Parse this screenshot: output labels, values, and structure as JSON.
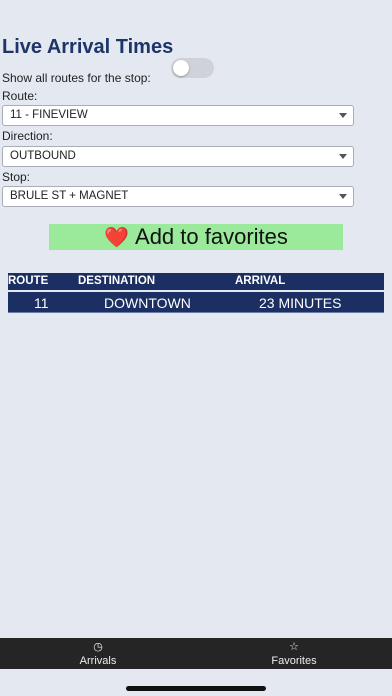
{
  "page": {
    "title": "Live Arrival Times",
    "show_all_label": "Show all routes for the stop:"
  },
  "toggle": {
    "on": false
  },
  "form": {
    "route": {
      "label": "Route:",
      "value": "11 - FINEVIEW"
    },
    "direction": {
      "label": "Direction:",
      "value": "OUTBOUND"
    },
    "stop": {
      "label": "Stop:",
      "value": "BRULE ST + MAGNET"
    }
  },
  "favorites_button": {
    "icon": "heart-icon",
    "glyph": "❤️",
    "label": "Add to favorites"
  },
  "table": {
    "headers": [
      "ROUTE",
      "DESTINATION",
      "ARRIVAL"
    ],
    "rows": [
      {
        "route": "11",
        "destination": "DOWNTOWN",
        "arrival": "23 MINUTES"
      }
    ]
  },
  "tabbar": {
    "items": [
      {
        "label": "Arrivals",
        "icon": "clock-icon",
        "glyph": "◷"
      },
      {
        "label": "Favorites",
        "icon": "star-icon",
        "glyph": "☆"
      }
    ]
  },
  "colors": {
    "background": "#e3e8f1",
    "title": "#1e3568",
    "table_header": "#1c2f63",
    "favorites_button": "#9be99a",
    "tabbar": "#252525"
  }
}
